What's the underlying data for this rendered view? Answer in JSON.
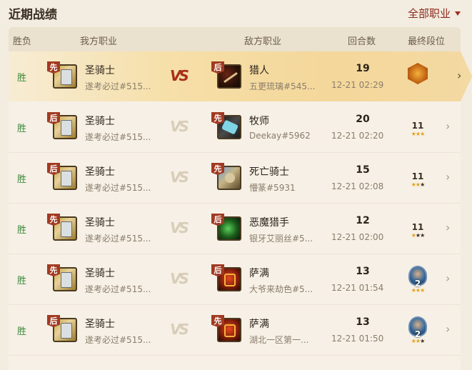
{
  "header": {
    "title": "近期战绩",
    "filter_label": "全部职业"
  },
  "columns": {
    "result": "胜负",
    "mine": "我方职业",
    "enemy": "敌方职业",
    "turns": "回合数",
    "rank": "最终段位"
  },
  "vs_label": "VS",
  "rows": [
    {
      "result": "胜",
      "my_turn": "先",
      "my_class": "圣骑士",
      "my_player": "遂考必过#515...",
      "enemy_turn": "后",
      "enemy_class": "猎人",
      "enemy_player": "五更琉璃#545...",
      "turns": "19",
      "time": "12-21 02:29",
      "rank_icon": "legend-gem-icon",
      "rank_num": "",
      "stars": ""
    },
    {
      "result": "胜",
      "my_turn": "后",
      "my_class": "圣骑士",
      "my_player": "遂考必过#515...",
      "enemy_turn": "先",
      "enemy_class": "牧师",
      "enemy_player": "Deekay#5962",
      "turns": "20",
      "time": "12-21 02:20",
      "rank_icon": "rank-11-icon",
      "rank_num": "11",
      "stars": "★★★"
    },
    {
      "result": "胜",
      "my_turn": "后",
      "my_class": "圣骑士",
      "my_player": "遂考必过#515...",
      "enemy_turn": "先",
      "enemy_class": "死亡骑士",
      "enemy_player": "懵篆#5931",
      "turns": "15",
      "time": "12-21 02:08",
      "rank_icon": "rank-11-icon",
      "rank_num": "11",
      "stars": "★★"
    },
    {
      "result": "胜",
      "my_turn": "先",
      "my_class": "圣骑士",
      "my_player": "遂考必过#515...",
      "enemy_turn": "后",
      "enemy_class": "恶魔猎手",
      "enemy_player": "银牙艾丽丝#5...",
      "turns": "12",
      "time": "12-21 02:00",
      "rank_icon": "rank-11-icon",
      "rank_num": "11",
      "stars": "★"
    },
    {
      "result": "胜",
      "my_turn": "先",
      "my_class": "圣骑士",
      "my_player": "遂考必过#515...",
      "enemy_turn": "后",
      "enemy_class": "萨满",
      "enemy_player": "大爷来劫色#5...",
      "turns": "13",
      "time": "12-21 01:54",
      "rank_icon": "rank-2-portrait-icon",
      "rank_num": "2",
      "stars": "★★★"
    },
    {
      "result": "胜",
      "my_turn": "后",
      "my_class": "圣骑士",
      "my_player": "遂考必过#515...",
      "enemy_turn": "先",
      "enemy_class": "萨满",
      "enemy_player": "湖北一区第一...",
      "turns": "13",
      "time": "12-21 01:50",
      "rank_icon": "rank-2-portrait-icon",
      "rank_num": "2",
      "stars": "★★"
    }
  ]
}
